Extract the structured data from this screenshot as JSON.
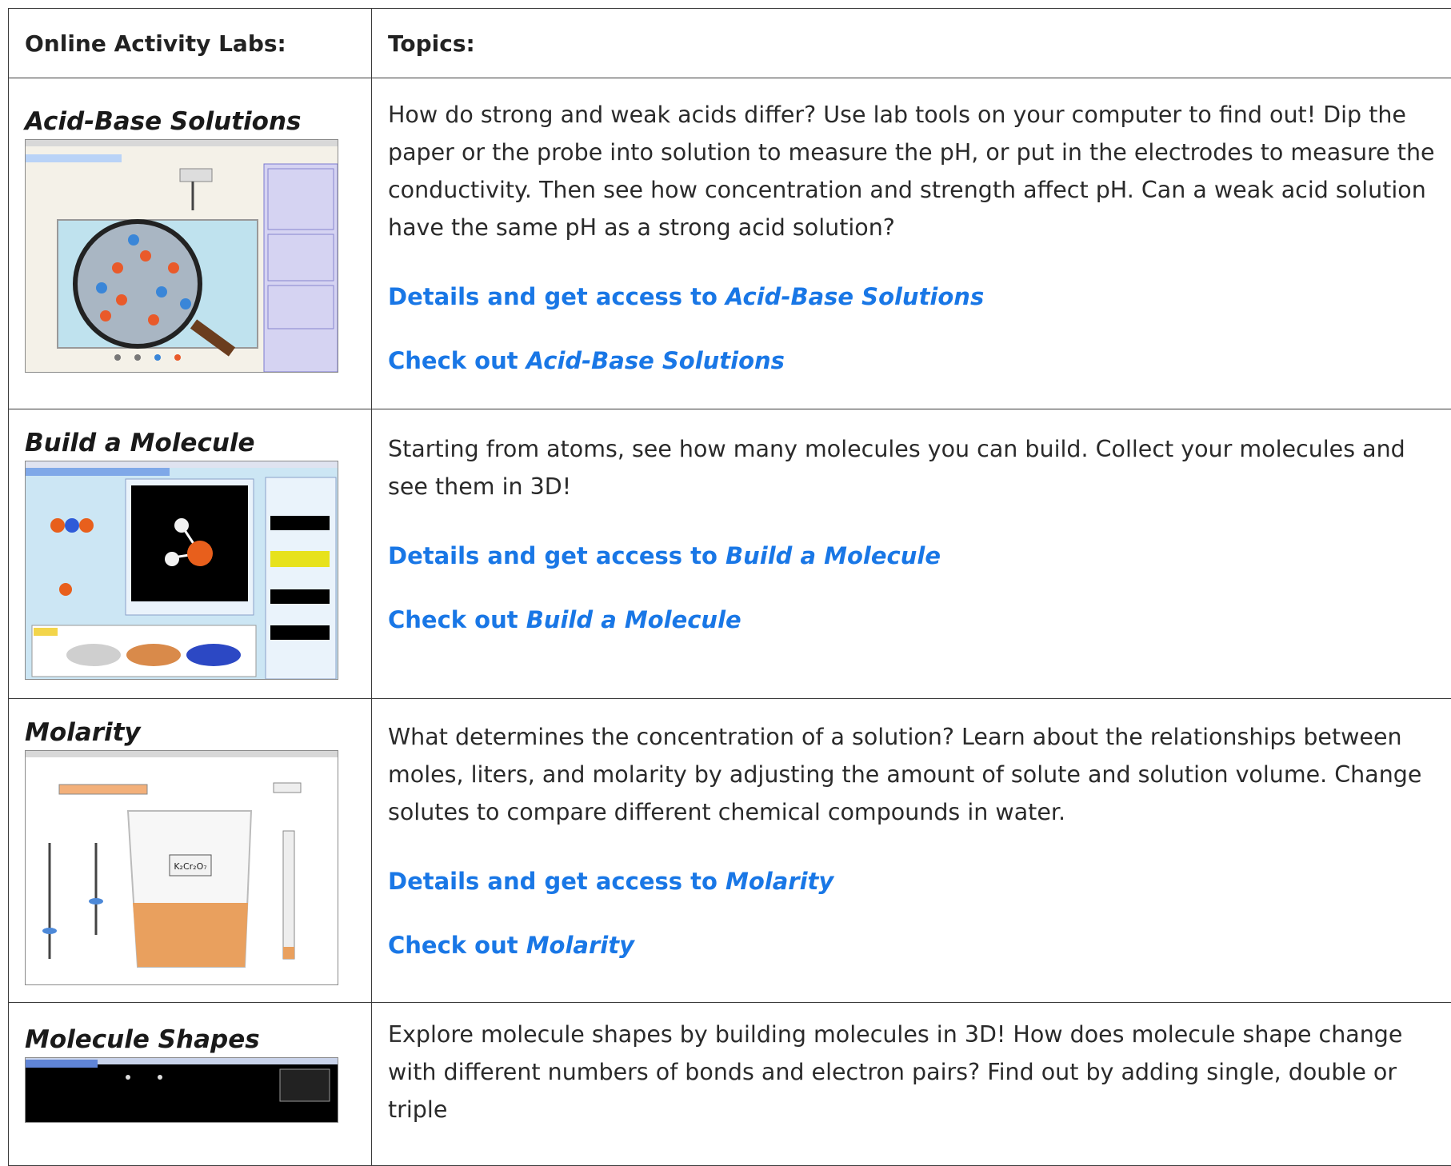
{
  "table": {
    "header_col1": "Online Activity Labs:",
    "header_col2": "Topics:"
  },
  "rows": [
    {
      "title": "Acid-Base Solutions",
      "description": "How do strong and weak acids differ? Use lab tools on your computer to find out! Dip the paper or the probe into solution to measure the pH, or put in the electrodes to measure the conductivity. Then see how concentration and strength affect pH. Can a weak acid solution have the same pH as a strong acid solution?",
      "details_prefix": "Details and get access to ",
      "details_name": "Acid-Base Solutions",
      "check_prefix": "Check out ",
      "check_name": "Acid-Base Solutions"
    },
    {
      "title": "Build a Molecule",
      "description": "Starting from atoms, see how many molecules you can build. Collect your molecules and see them in 3D!",
      "details_prefix": "Details and get access to ",
      "details_name": "Build a Molecule",
      "check_prefix": "Check out ",
      "check_name": "Build a Molecule"
    },
    {
      "title": "Molarity",
      "description": "What determines the concentration of a solution? Learn about the relationships between moles, liters, and molarity by adjusting the amount of solute and solution volume. Change solutes to compare different chemical compounds in water.",
      "details_prefix": "Details and get access to ",
      "details_name": "Molarity",
      "check_prefix": "Check out ",
      "check_name": "Molarity",
      "beaker_label": "K₂Cr₂O₇"
    },
    {
      "title": "Molecule Shapes",
      "description": "Explore molecule shapes by building molecules in 3D! How does molecule shape change with different numbers of bonds and electron pairs? Find out by adding single, double or triple"
    }
  ],
  "colors": {
    "link": "#1977e6",
    "border": "#3b3b3b"
  }
}
